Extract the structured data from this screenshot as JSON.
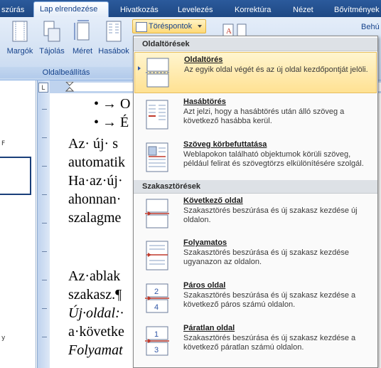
{
  "tabs": [
    "szúrás",
    "Lap elrendezése",
    "Hivatkozás",
    "Levelezés",
    "Korrektúra",
    "Nézet",
    "Bővítmények"
  ],
  "ribbon": {
    "buttons": [
      "Margók",
      "Tájolás",
      "Méret",
      "Hasábok"
    ],
    "group_label": "Oldalbeállítás",
    "breaks_button": "Töréspontok",
    "right_fragment": "Behú"
  },
  "ruler_corner": "L",
  "left_pane_chars": [
    "F",
    "y"
  ],
  "document": {
    "bullet_lines": [
      "• → O",
      "• → É"
    ],
    "lines": [
      "Az· új· s",
      "automatik",
      "Ha·az·új·",
      "ahonnan·",
      "szalagme",
      "Az·ablak",
      "szakasz.¶",
      "Új·oldal:·",
      "a·követke",
      "Folyamat"
    ]
  },
  "menu": {
    "sections": [
      {
        "title": "Oldaltörések",
        "items": [
          {
            "title": "Oldaltörés",
            "desc": "Az egyik oldal végét és az új oldal kezdőpontját jelöli.",
            "icon": "page-break-icon",
            "highlighted": true
          },
          {
            "title": "Hasábtörés",
            "desc": "Azt jelzi, hogy a hasábtörés után álló szöveg a következő hasábba kerül.",
            "icon": "column-break-icon",
            "highlighted": false
          },
          {
            "title": "Szöveg körbefuttatása",
            "desc": "Weblapokon található objektumok körüli szöveg, például felirat és szövegtörzs elkülönítésére szolgál.",
            "icon": "text-wrapping-icon",
            "highlighted": false
          }
        ]
      },
      {
        "title": "Szakasztörések",
        "items": [
          {
            "title": "Következő oldal",
            "desc": "Szakasztörés beszúrása és új szakasz kezdése új oldalon.",
            "icon": "next-page-icon",
            "highlighted": false
          },
          {
            "title": "Folyamatos",
            "desc": "Szakasztörés beszúrása és új szakasz kezdése ugyanazon az oldalon.",
            "icon": "continuous-icon",
            "highlighted": false
          },
          {
            "title": "Páros oldal",
            "desc": "Szakasztörés beszúrása és új szakasz kezdése a következő páros számú oldalon.",
            "icon": "even-page-icon",
            "highlighted": false
          },
          {
            "title": "Páratlan oldal",
            "desc": "Szakasztörés beszúrása és új szakasz kezdése a következő páratlan számú oldalon.",
            "icon": "odd-page-icon",
            "highlighted": false
          }
        ]
      }
    ]
  },
  "colors": {
    "accent": "#2b5a9c",
    "highlight": "#ffe192",
    "break_line": "#c0392b"
  }
}
